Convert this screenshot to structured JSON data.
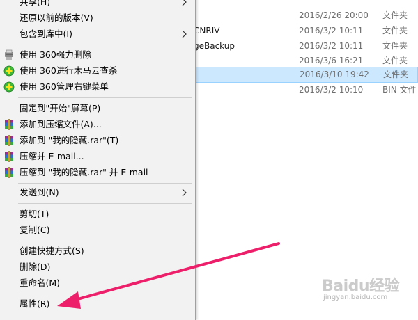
{
  "file_list": {
    "rows": [
      {
        "name": "",
        "date": "2016/2/26 20:00",
        "type": "文件夹",
        "selected": false
      },
      {
        "name": "CNRIV",
        "date": "2016/3/2 10:11",
        "type": "文件夹",
        "selected": false
      },
      {
        "name": "geBackup",
        "date": "2016/3/2 10:11",
        "type": "文件夹",
        "selected": false
      },
      {
        "name": "",
        "date": "2016/3/6 16:21",
        "type": "文件夹",
        "selected": false
      },
      {
        "name": "",
        "date": "2016/3/10 19:42",
        "type": "文件夹",
        "selected": true
      },
      {
        "name": "",
        "date": "2016/3/2 10:10",
        "type": "BIN 文件",
        "selected": false
      }
    ]
  },
  "context_menu": {
    "items": [
      {
        "label": "共享(H)",
        "icon": "",
        "submenu": true
      },
      {
        "label": "还原以前的版本(V)",
        "icon": "",
        "submenu": false
      },
      {
        "label": "包含到库中(I)",
        "icon": "",
        "submenu": true
      },
      {
        "label": "使用 360强力删除",
        "icon": "shredder-icon",
        "submenu": false
      },
      {
        "label": "使用 360进行木马云查杀",
        "icon": "360-shield-icon",
        "submenu": false
      },
      {
        "label": "使用 360管理右键菜单",
        "icon": "360-shield-icon",
        "submenu": false
      },
      {
        "label": "固定到\"开始\"屏幕(P)",
        "icon": "",
        "submenu": false
      },
      {
        "label": "添加到压缩文件(A)...",
        "icon": "winrar-icon",
        "submenu": false
      },
      {
        "label": "添加到 \"我的隐藏.rar\"(T)",
        "icon": "winrar-icon",
        "submenu": false
      },
      {
        "label": "压缩并 E-mail...",
        "icon": "winrar-icon",
        "submenu": false
      },
      {
        "label": "压缩到 \"我的隐藏.rar\" 并 E-mail",
        "icon": "winrar-icon",
        "submenu": false
      },
      {
        "label": "发送到(N)",
        "icon": "",
        "submenu": true
      },
      {
        "label": "剪切(T)",
        "icon": "",
        "submenu": false
      },
      {
        "label": "复制(C)",
        "icon": "",
        "submenu": false
      },
      {
        "label": "创建快捷方式(S)",
        "icon": "",
        "submenu": false
      },
      {
        "label": "删除(D)",
        "icon": "",
        "submenu": false
      },
      {
        "label": "重命名(M)",
        "icon": "",
        "submenu": false
      },
      {
        "label": "属性(R)",
        "icon": "",
        "submenu": false
      }
    ]
  },
  "annotation": {
    "color": "#ee1f6a",
    "points_to": "属性(R)"
  },
  "watermark": {
    "logo": "Baidu经验",
    "url": "jingyan.baidu.com"
  },
  "colors": {
    "menu_bg": "#f2f2f2",
    "selection_bg": "#cce8ff",
    "selection_border": "#99d1ff",
    "arrow": "#ee1f6a"
  }
}
